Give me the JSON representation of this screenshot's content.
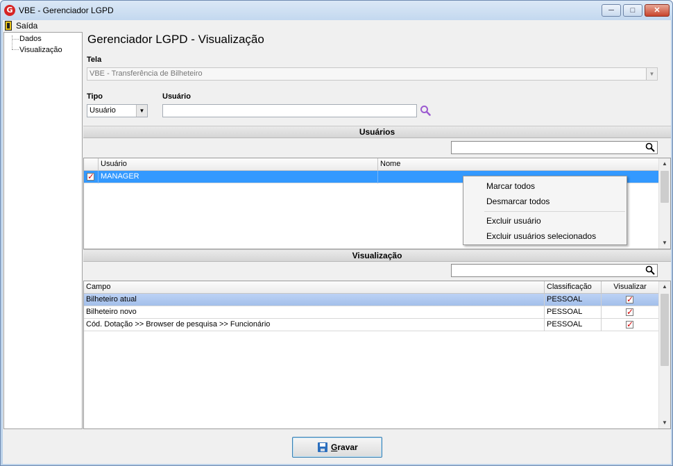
{
  "window": {
    "title": "VBE - Gerenciador LGPD",
    "app_icon_letter": "G",
    "controls": [
      "minimize-icon",
      "maximize-icon",
      "close-icon"
    ]
  },
  "menubar": {
    "exit_label": "Saída",
    "exit_icon": "exit-door-icon"
  },
  "tree": {
    "items": [
      "Dados",
      "Visualização"
    ]
  },
  "page": {
    "title": "Gerenciador LGPD - Visualização"
  },
  "tela": {
    "label": "Tela",
    "value": "VBE - Transferência de Bilheteiro"
  },
  "tipo": {
    "label": "Tipo",
    "value": "Usuário"
  },
  "usuario": {
    "label": "Usuário",
    "value": ""
  },
  "usuarios_section": {
    "title": "Usuários",
    "filter_value": "",
    "columns": [
      "Usuário",
      "Nome"
    ],
    "rows": [
      {
        "checked": true,
        "usuario": "MANAGER",
        "nome": ""
      }
    ]
  },
  "context_menu": {
    "items": [
      "Marcar todos",
      "Desmarcar todos",
      "Excluir usuário",
      "Excluir usuários selecionados"
    ]
  },
  "visualizacao_section": {
    "title": "Visualização",
    "filter_value": "",
    "columns": [
      "Campo",
      "Classificação",
      "Visualizar"
    ],
    "rows": [
      {
        "campo": "Bilheteiro atual",
        "classificacao": "PESSOAL",
        "visualizar": true
      },
      {
        "campo": "Bilheteiro novo",
        "classificacao": "PESSOAL",
        "visualizar": true
      },
      {
        "campo": "Cód. Dotação >> Browser de pesquisa >> Funcionário",
        "classificacao": "PESSOAL",
        "visualizar": true
      }
    ]
  },
  "footer": {
    "save_label_mnemonic": "G",
    "save_label_rest": "ravar"
  },
  "colors": {
    "selection": "#3399ff",
    "check": "#d00000",
    "search_accent": "#9b59d0"
  }
}
